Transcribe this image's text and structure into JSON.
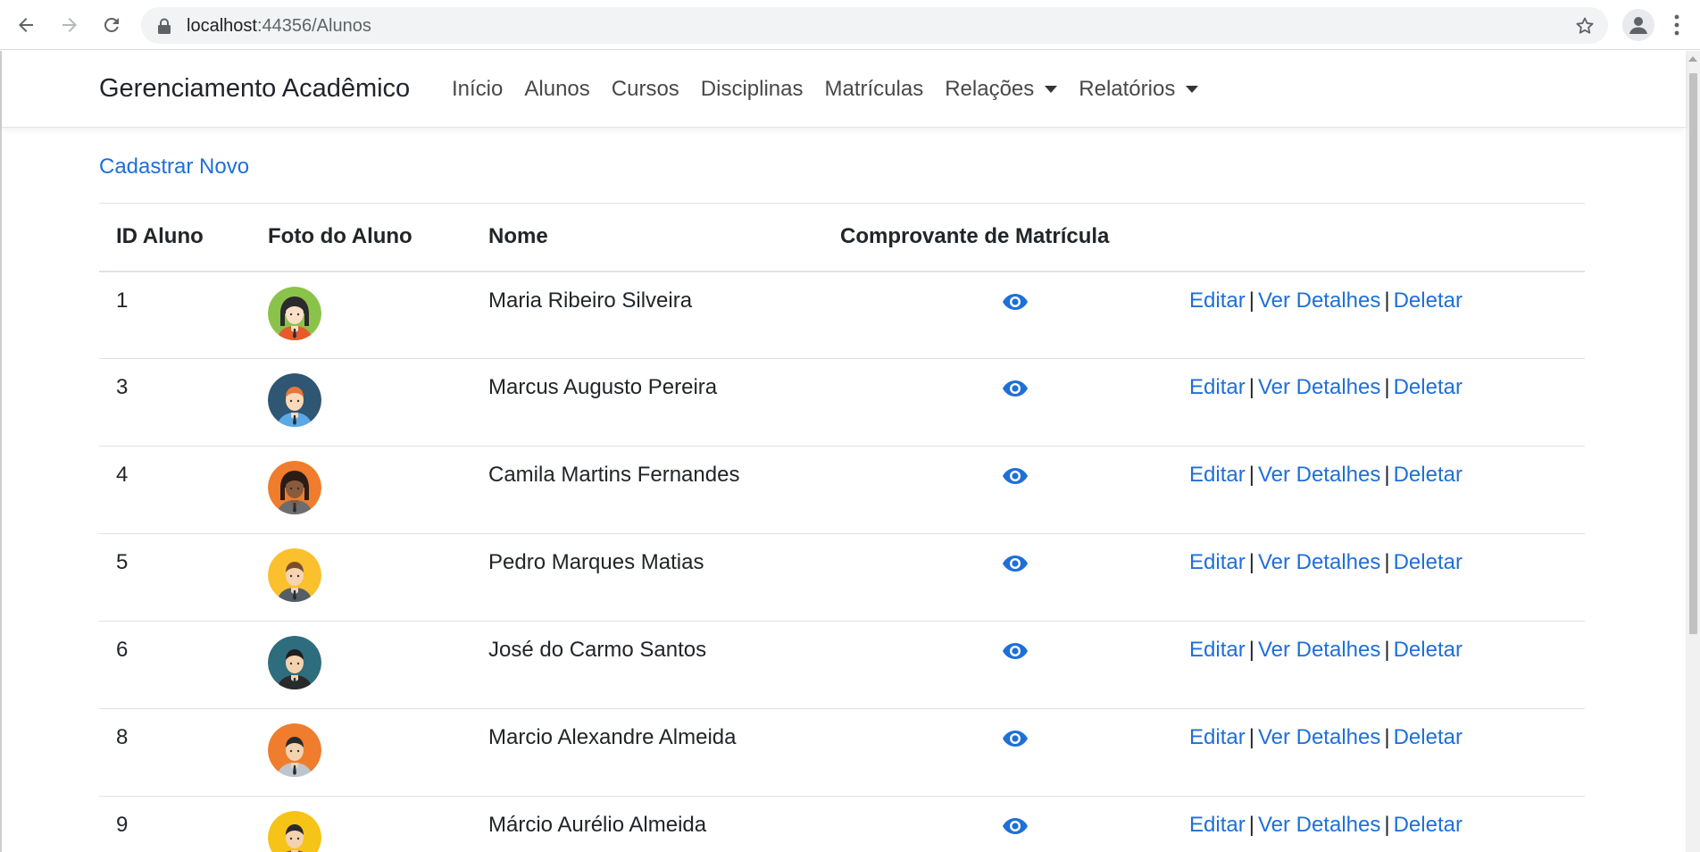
{
  "browser": {
    "url_host": "localhost",
    "url_path": ":44356/Alunos"
  },
  "navbar": {
    "brand": "Gerenciamento Acadêmico",
    "links": [
      "Início",
      "Alunos",
      "Cursos",
      "Disciplinas",
      "Matrículas"
    ],
    "dropdowns": [
      "Relações",
      "Relatórios"
    ]
  },
  "main": {
    "create_link": "Cadastrar Novo",
    "table": {
      "headers": [
        "ID Aluno",
        "Foto do Aluno",
        "Nome",
        "Comprovante de Matrícula",
        ""
      ],
      "action_labels": {
        "edit": "Editar",
        "details": "Ver Detalhes",
        "delete": "Deletar",
        "separator": "|"
      },
      "rows": [
        {
          "id": "1",
          "name": "Maria Ribeiro Silveira",
          "avatar_bg": "#8bc34a",
          "hair": "#2b2b2b",
          "skin": "#fbe0c8",
          "shirt": "#e65a2b",
          "long_hair": true
        },
        {
          "id": "3",
          "name": "Marcus Augusto Pereira",
          "avatar_bg": "#2f5673",
          "hair": "#e8763a",
          "skin": "#fcd9b8",
          "shirt": "#5aa9e6",
          "long_hair": false
        },
        {
          "id": "4",
          "name": "Camila Martins Fernandes",
          "avatar_bg": "#ef7d2d",
          "hair": "#2b1d16",
          "skin": "#8a5a3c",
          "shirt": "#6d6d6d",
          "long_hair": true
        },
        {
          "id": "5",
          "name": "Pedro Marques Matias",
          "avatar_bg": "#fbc02d",
          "hair": "#7a4e2d",
          "skin": "#f6d4b2",
          "shirt": "#555e66",
          "long_hair": false
        },
        {
          "id": "6",
          "name": "José do Carmo Santos",
          "avatar_bg": "#2e6d7e",
          "hair": "#1f1f1f",
          "skin": "#f3d2b0",
          "shirt": "#2a2a2a",
          "long_hair": false
        },
        {
          "id": "8",
          "name": "Marcio Alexandre Almeida",
          "avatar_bg": "#ef7d2d",
          "hair": "#2a2a2a",
          "skin": "#f3d2b0",
          "shirt": "#bfc5cc",
          "long_hair": false
        },
        {
          "id": "9",
          "name": "Márcio Aurélio Almeida",
          "avatar_bg": "#f6c416",
          "hair": "#2a2a2a",
          "skin": "#f3d2b0",
          "shirt": "#8a5a3c",
          "long_hair": false
        }
      ]
    }
  }
}
